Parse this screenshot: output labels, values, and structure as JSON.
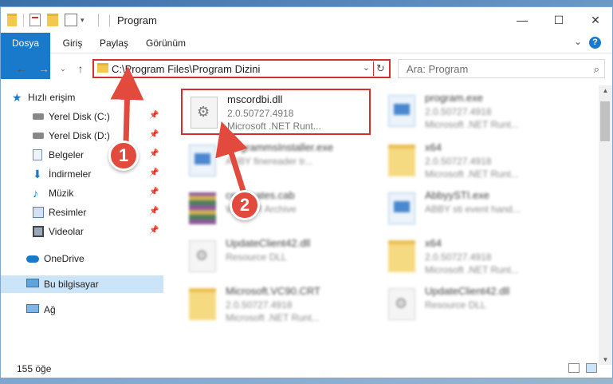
{
  "window": {
    "title": "Program"
  },
  "ribbon": {
    "tabs": [
      "Dosya",
      "Giriş",
      "Paylaş",
      "Görünüm"
    ],
    "help": "?"
  },
  "address": {
    "path": "C:\\Program Files\\Program Dizini",
    "search_placeholder": "Ara: Program"
  },
  "sidebar": {
    "items": [
      {
        "label": "Hızlı erişim",
        "icon": "star-icon"
      },
      {
        "label": "Yerel Disk (C:)",
        "icon": "drive-icon",
        "pinned": true
      },
      {
        "label": "Yerel Disk (D:)",
        "icon": "drive-icon",
        "pinned": true
      },
      {
        "label": "Belgeler",
        "icon": "documents-icon",
        "pinned": true
      },
      {
        "label": "İndirmeler",
        "icon": "download-icon",
        "pinned": true
      },
      {
        "label": "Müzik",
        "icon": "music-icon",
        "pinned": true
      },
      {
        "label": "Resimler",
        "icon": "pictures-icon",
        "pinned": true
      },
      {
        "label": "Videolar",
        "icon": "videos-icon",
        "pinned": true
      },
      {
        "label": "OneDrive",
        "icon": "cloud-icon"
      },
      {
        "label": "Bu bilgisayar",
        "icon": "computer-icon",
        "selected": true
      },
      {
        "label": "Ağ",
        "icon": "network-icon"
      }
    ]
  },
  "files": [
    {
      "name": "mscordbi.dll",
      "line1": "2.0.50727.4918",
      "line2": "Microsoft .NET Runt...",
      "icon": "dll-icon",
      "highlighted": true
    },
    {
      "name": "program.exe",
      "line1": "2.0.50727.4918",
      "line2": "Microsoft .NET Runt...",
      "icon": "exe-icon"
    },
    {
      "name": "programmsInstaller.exe",
      "line1": "ABBY finereader tr...",
      "line2": "",
      "icon": "exe-icon"
    },
    {
      "name": "x64",
      "line1": "2.0.50727.4918",
      "line2": "Microsoft .NET Runt...",
      "icon": "folder-icon"
    },
    {
      "name": "certificates.cab",
      "line1": "WinRAR Archive",
      "line2": "",
      "icon": "archive-icon"
    },
    {
      "name": "AbbyySTI.exe",
      "line1": "ABBY sti event hand...",
      "line2": "",
      "icon": "exe-icon"
    },
    {
      "name": "UpdateClient42.dll",
      "line1": "Resource DLL",
      "line2": "",
      "icon": "dll-icon"
    },
    {
      "name": "x64",
      "line1": "2.0.50727.4918",
      "line2": "Microsoft .NET Runt...",
      "icon": "folder-icon"
    },
    {
      "name": "Microsoft.VC90.CRT",
      "line1": "2.0.50727.4918",
      "line2": "Microsoft .NET Runt...",
      "icon": "folder-icon"
    },
    {
      "name": "UpdateClient42.dll",
      "line1": "Resource DLL",
      "line2": "",
      "icon": "dll-icon"
    }
  ],
  "status": {
    "count": "155 öğe"
  },
  "annotations": {
    "step1": "1",
    "step2": "2"
  },
  "colors": {
    "accent": "#1979ca",
    "highlight": "#d32f2f",
    "badge": "#e24a3e"
  }
}
